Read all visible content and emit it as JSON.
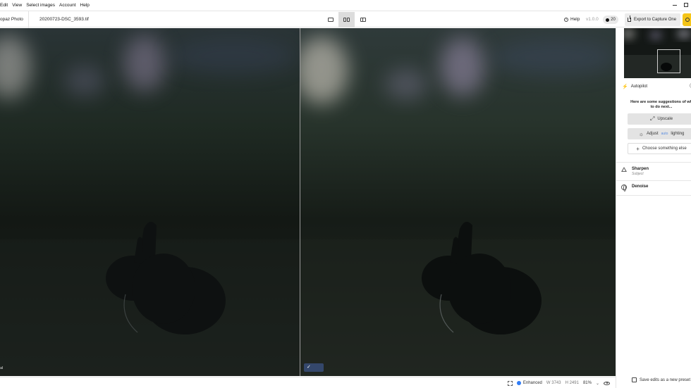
{
  "menu": {
    "items": [
      "Edit",
      "View",
      "Select images",
      "Account",
      "Help"
    ]
  },
  "toolbar": {
    "app_name": "opaz Photo",
    "file_name": "20200723-DSC_3593.tif",
    "help_label": "Help",
    "version": "v1.0.0",
    "credits": "20",
    "export_label": "Export to Capture One"
  },
  "viewer": {
    "left_label": "al",
    "check_label": "✓"
  },
  "status": {
    "enhanced_label": "Enhanced",
    "width_label": "W 3743",
    "height_label": "H 2491",
    "zoom": "81%"
  },
  "sidebar": {
    "autopilot_label": "Autopilot",
    "suggestion_text": "Here are some suggestions of wh to do next...",
    "buttons": {
      "upscale": "Upscale",
      "adjust_prefix": "Adjust",
      "adjust_auto": "auto",
      "adjust_suffix": "lighting",
      "choose": "Choose something else"
    },
    "models": [
      {
        "name": "Sharpen",
        "sub": "Subject"
      },
      {
        "name": "Denoise"
      }
    ],
    "save_preset_label": "Save edits as a new preset"
  },
  "colors": {
    "accent": "#f5c518",
    "enhanced_dot": "#2f7cf6",
    "check_badge": "#34476b"
  }
}
